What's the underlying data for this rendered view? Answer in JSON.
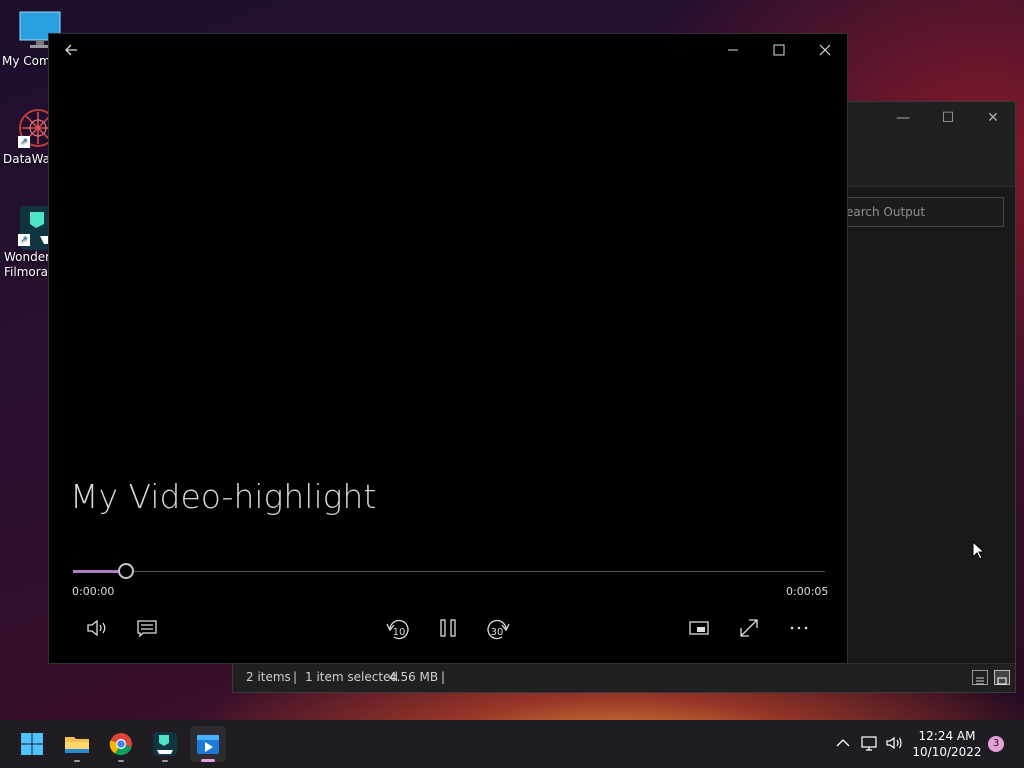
{
  "desktop": {
    "icons": [
      {
        "label": "My Com"
      },
      {
        "label": "DataWag"
      },
      {
        "label": "Wonders\nFilmora"
      }
    ]
  },
  "explorer": {
    "search_placeholder": "earch Output",
    "status": {
      "items": "2 items",
      "selected": "1 item selected",
      "size": "4.56 MB"
    }
  },
  "player": {
    "video_title": "My Video-highlight",
    "elapsed": "0:00:00",
    "duration": "0:00:05",
    "progress_fraction": 0.07,
    "skip_back_label": "10",
    "skip_forward_label": "30",
    "accent_color": "#b27cc2"
  },
  "taskbar": {
    "apps": [
      "start",
      "file-explorer",
      "chrome",
      "filmora",
      "media-player"
    ],
    "time": "12:24 AM",
    "date": "10/10/2022",
    "notification_count": "3"
  }
}
